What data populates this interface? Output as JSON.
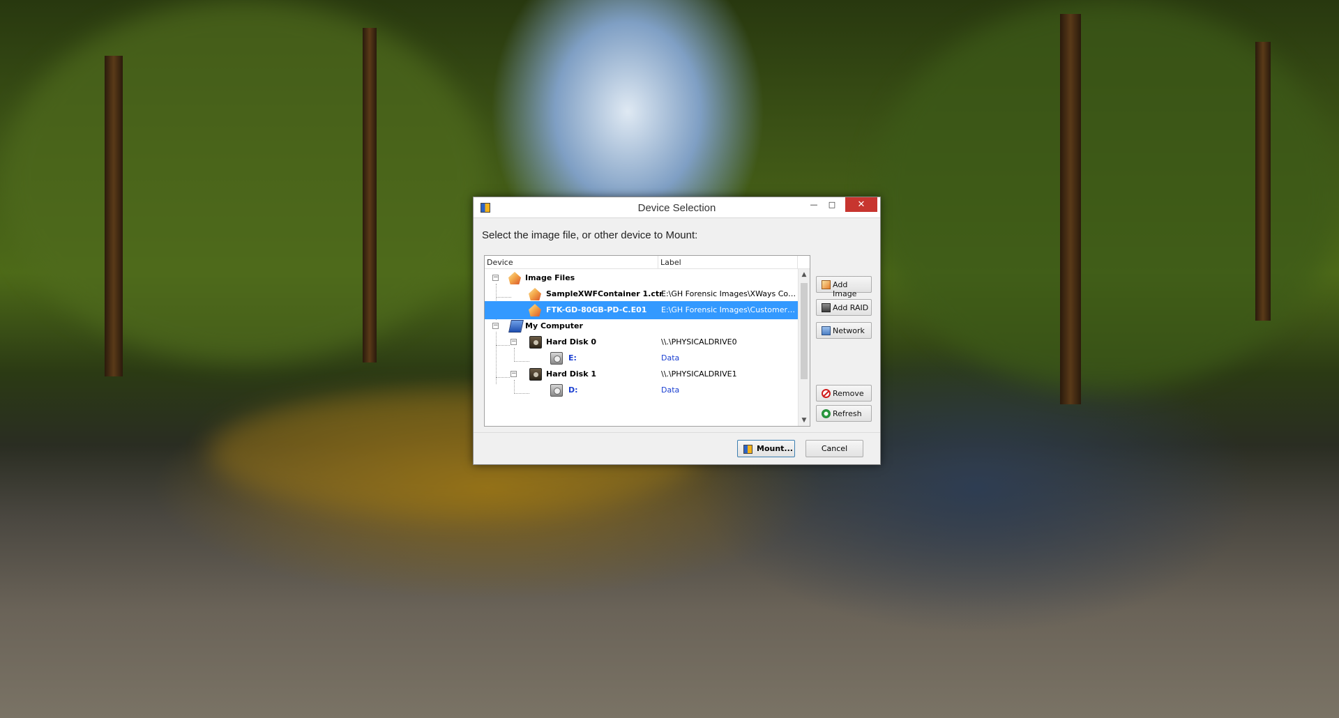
{
  "window": {
    "title": "Device Selection",
    "minimize_glyph": "—",
    "maximize_glyph": "□",
    "close_glyph": "✕"
  },
  "instruction": "Select the image file, or other device to Mount:",
  "list": {
    "columns": {
      "device": "Device",
      "label": "Label"
    },
    "rows": [
      {
        "name": "Image Files",
        "label": ""
      },
      {
        "name": "SampleXWFContainer 1.ctr",
        "label": "E:\\GH Forensic Images\\XWays Cont..."
      },
      {
        "name": "FTK-GD-80GB-PD-C.E01",
        "label": "E:\\GH Forensic Images\\Customer I..."
      },
      {
        "name": "My Computer",
        "label": ""
      },
      {
        "name": "Hard Disk 0",
        "label": "\\\\.\\PHYSICALDRIVE0"
      },
      {
        "name": "E:",
        "label": "Data"
      },
      {
        "name": "Hard Disk 1",
        "label": "\\\\.\\PHYSICALDRIVE1"
      },
      {
        "name": "D:",
        "label": "Data"
      }
    ],
    "selected_index": 2
  },
  "buttons": {
    "add_image": "Add Image",
    "add_raid": "Add RAID",
    "network": "Network",
    "remove": "Remove",
    "refresh": "Refresh",
    "mount": "Mount...",
    "cancel": "Cancel"
  },
  "colors": {
    "selection": "#3399ff",
    "close_button": "#c7352f",
    "volume_text": "#1a3fd1"
  }
}
